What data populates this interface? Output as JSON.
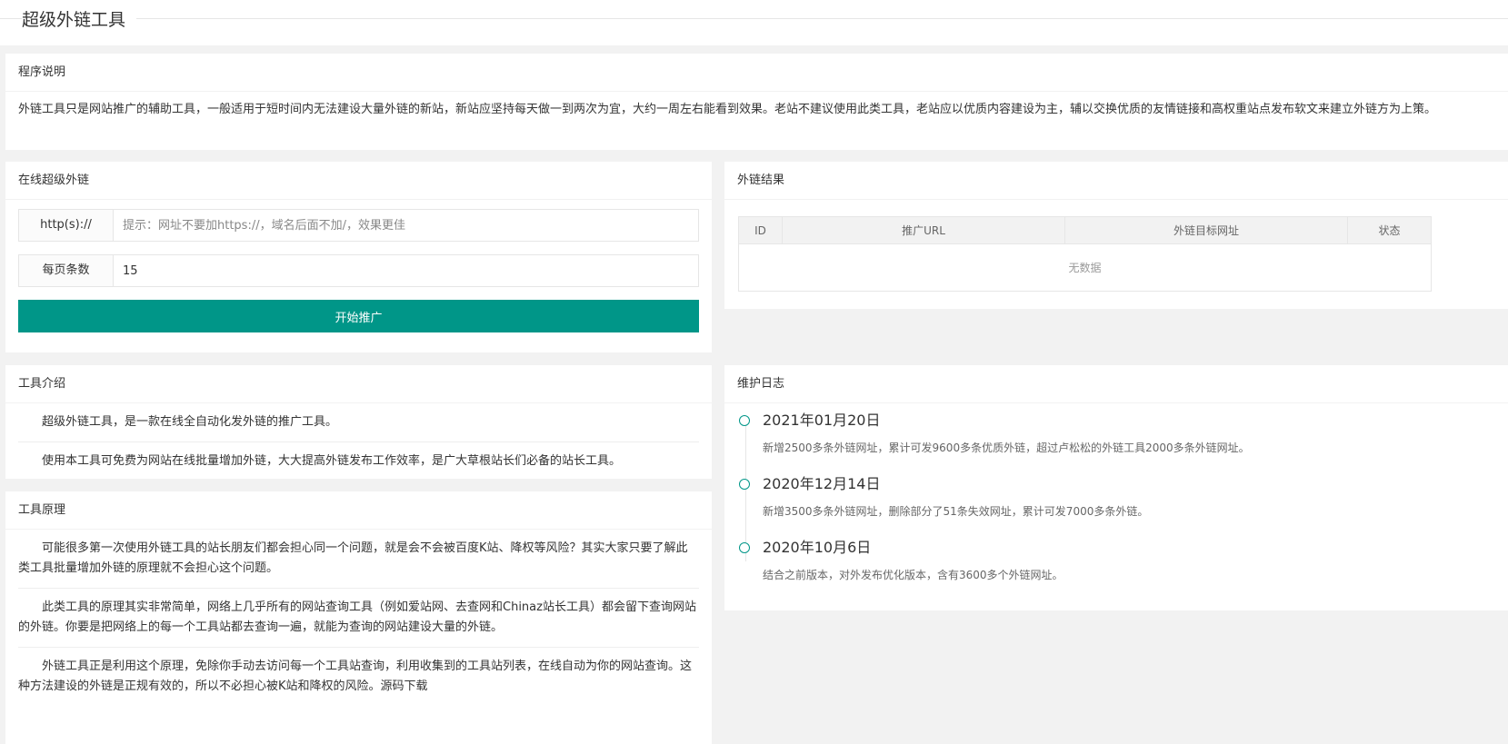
{
  "header": {
    "title": "超级外链工具"
  },
  "description": {
    "title": "程序说明",
    "text": "外链工具只是网站推广的辅助工具，一般适用于短时间内无法建设大量外链的新站，新站应坚持每天做一到两次为宜，大约一周左右能看到效果。老站不建议使用此类工具，老站应以优质内容建设为主，辅以交换优质的友情链接和高权重站点发布软文来建立外链方为上策。"
  },
  "form": {
    "title": "在线超级外链",
    "url_label": "http(s)://",
    "url_placeholder": "提示：网址不要加https://，域名后面不加/，效果更佳",
    "count_label": "每页条数",
    "count_value": "15",
    "submit_label": "开始推广"
  },
  "results": {
    "title": "外链结果",
    "columns": [
      "ID",
      "推广URL",
      "外链目标网址",
      "状态"
    ],
    "empty_text": "无数据"
  },
  "intro": {
    "title": "工具介绍",
    "paragraphs": [
      "超级外链工具，是一款在线全自动化发外链的推广工具。",
      "使用本工具可免费为网站在线批量增加外链，大大提高外链发布工作效率，是广大草根站长们必备的站长工具。"
    ]
  },
  "principle": {
    "title": "工具原理",
    "paragraphs": [
      "可能很多第一次使用外链工具的站长朋友们都会担心同一个问题，就是会不会被百度K站、降权等风险？其实大家只要了解此类工具批量增加外链的原理就不会担心这个问题。",
      "此类工具的原理其实非常简单，网络上几乎所有的网站查询工具（例如爱站网、去查网和Chinaz站长工具）都会留下查询网站的外链。你要是把网络上的每一个工具站都去查询一遍，就能为查询的网站建设大量的外链。",
      "外链工具正是利用这个原理，免除你手动去访问每一个工具站查询，利用收集到的工具站列表，在线自动为你的网站查询。这种方法建设的外链是正规有效的，所以不必担心被K站和降权的风险。"
    ],
    "source_link": "源码下载"
  },
  "changelog": {
    "title": "维护日志",
    "items": [
      {
        "date": "2021年01月20日",
        "text": "新增2500多条外链网址，累计可发9600多条优质外链，超过卢松松的外链工具2000多条外链网址。"
      },
      {
        "date": "2020年12月14日",
        "text": "新增3500多条外链网址，删除部分了51条失效网址，累计可发7000多条外链。"
      },
      {
        "date": "2020年10月6日",
        "text": "结合之前版本，对外发布优化版本，含有3600多个外链网址。"
      }
    ]
  },
  "colors": {
    "accent": "#009688",
    "background": "#f2f2f2",
    "card": "#ffffff"
  }
}
